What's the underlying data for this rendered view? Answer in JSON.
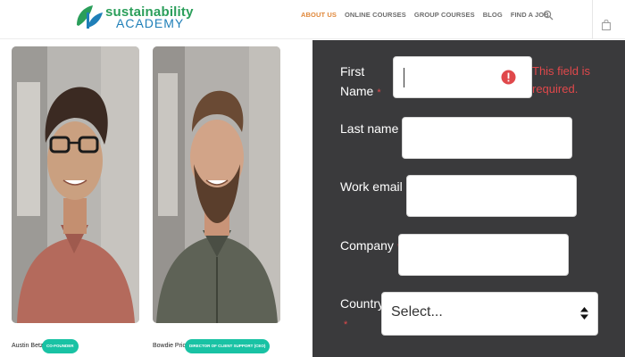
{
  "brand": {
    "line1": "sustainability",
    "line2": "ACADEMY"
  },
  "nav": {
    "items": [
      {
        "label": "ABOUT US",
        "active": true
      },
      {
        "label": "ONLINE COURSES",
        "active": false
      },
      {
        "label": "GROUP COURSES",
        "active": false
      },
      {
        "label": "BLOG",
        "active": false
      },
      {
        "label": "FIND A JOB",
        "active": false
      }
    ],
    "search_icon": "search-icon",
    "cart_icon": "shopping-bag-icon"
  },
  "team": [
    {
      "name": "Austin Betzer",
      "role": "CO-FOUNDER"
    },
    {
      "name": "Bowdie Price",
      "role": "DIRECTOR OF CLIENT SUPPORT (CEO)"
    }
  ],
  "form": {
    "first_name": {
      "label_line1": "First",
      "label_line2": "Name",
      "required": "*",
      "value": "",
      "error_line1": "This field is",
      "error_line2": "required."
    },
    "last_name": {
      "label": "Last name",
      "required": "*",
      "value": ""
    },
    "work_email": {
      "label": "Work email",
      "required": "*",
      "value": ""
    },
    "company": {
      "label": "Company",
      "required": "*",
      "value": ""
    },
    "country": {
      "label": "Country",
      "required": "*",
      "value": "Select..."
    }
  },
  "colors": {
    "accent": "#e0883b",
    "brand_green": "#2a9e5a",
    "brand_blue": "#1f7fb8",
    "badge": "#19c2a4",
    "error": "#e0484b",
    "panel": "#3a3a3c"
  }
}
